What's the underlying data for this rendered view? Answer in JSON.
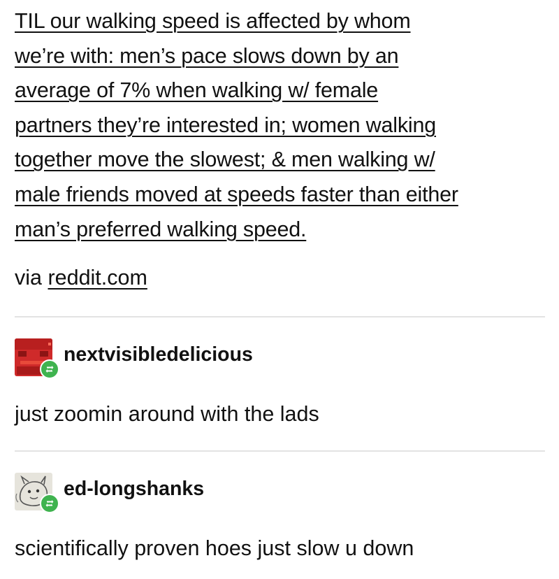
{
  "original_post": {
    "lines": [
      "TIL our walking speed is affected by whom",
      "we’re with: men’s pace slows down by an",
      "average of 7% when walking w/ female",
      "partners they’re interested in; women walking",
      "together move the slowest; & men walking w/",
      "male friends moved at speeds faster than either",
      "man’s preferred walking speed."
    ],
    "via_prefix": "via",
    "via_link": "reddit.com"
  },
  "reblogs": [
    {
      "username": "nextvisibledelicious",
      "text": "just zoomin around with the lads",
      "avatar_icon": "red-block-avatar-icon",
      "badge_icon": "reblog-icon"
    },
    {
      "username": "ed-longshanks",
      "text": "scientifically proven hoes just slow u down",
      "avatar_icon": "sketch-creature-avatar-icon",
      "badge_icon": "reblog-icon"
    }
  ],
  "colors": {
    "text": "#111111",
    "divider": "#e3e3e3",
    "reblog_badge": "#3fb34f",
    "avatar_red": "#cf2a2a"
  }
}
